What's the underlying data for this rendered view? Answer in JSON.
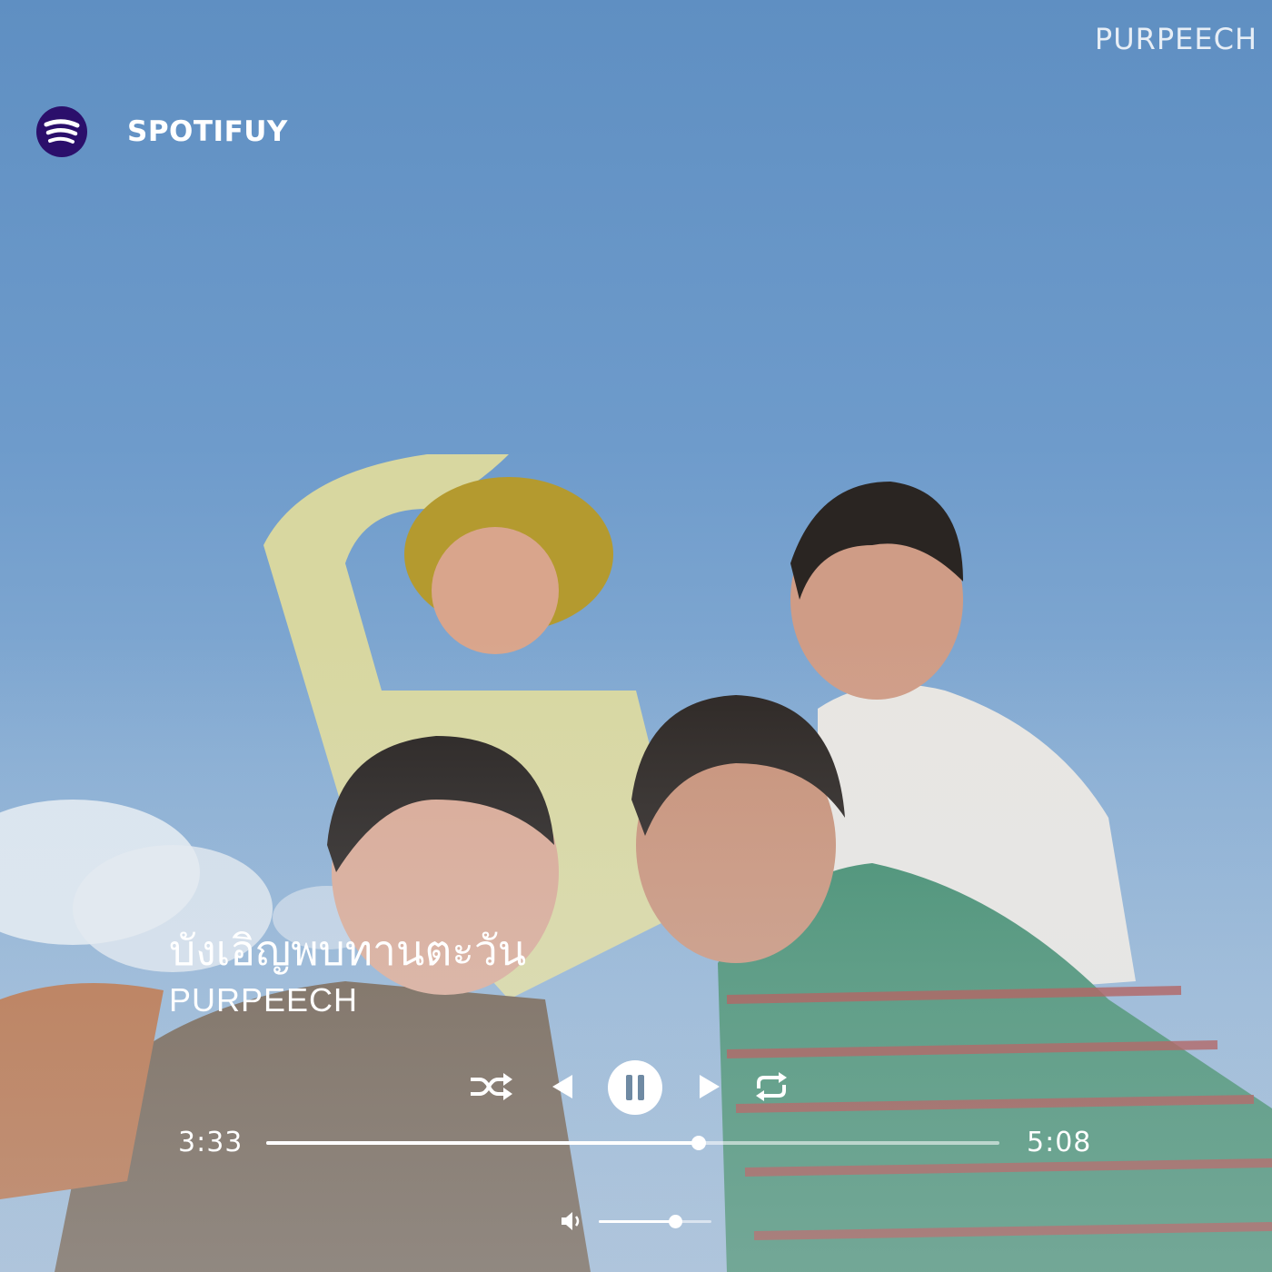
{
  "header": {
    "app_name": "SPOTIFUY",
    "watermark": "PURPEECH"
  },
  "track": {
    "title": "บังเอิญพบทานตะวัน",
    "artist": "PURPEECH"
  },
  "playback": {
    "elapsed": "3:33",
    "total": "5:08",
    "progress_fraction": 0.59,
    "state": "playing",
    "volume_fraction": 0.68
  },
  "icons": {
    "logo": "spotify-logo-icon",
    "shuffle": "shuffle-icon",
    "previous": "previous-icon",
    "pause": "pause-icon",
    "next": "next-icon",
    "repeat": "repeat-icon",
    "volume": "volume-icon"
  },
  "colors": {
    "logo_background": "#2b0f6b",
    "text": "#ffffff",
    "sky": "#6e9bcb"
  }
}
